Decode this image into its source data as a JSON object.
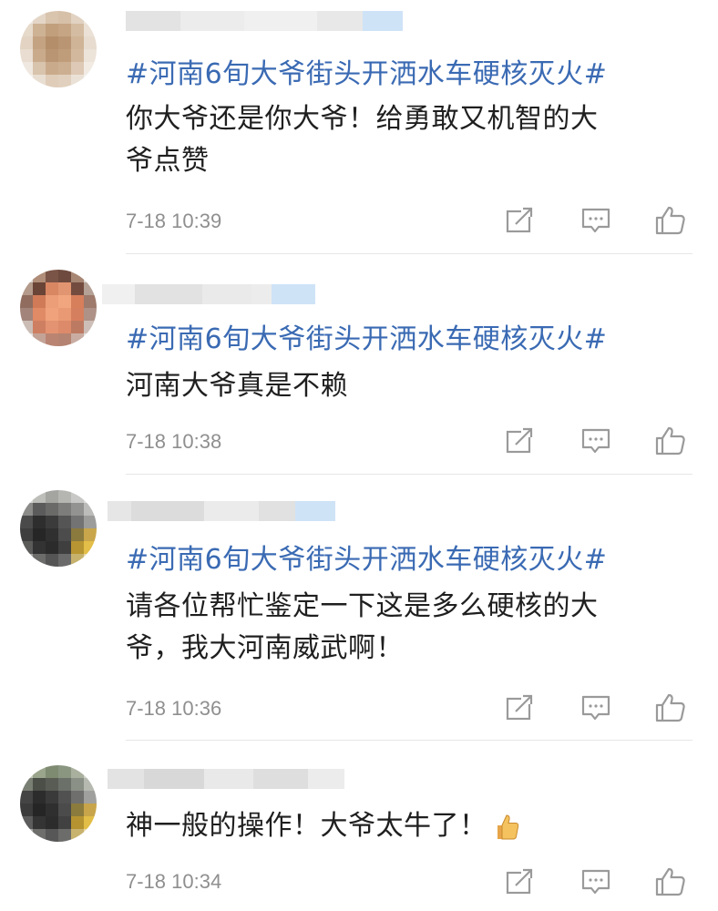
{
  "comments": [
    {
      "hashtag": "#河南6旬大爷街头开洒水车硬核灭火#",
      "lines": [
        "你大爷还是你大爷！给勇敢又机智的大",
        "爷点赞"
      ],
      "time": "7-18 10:39"
    },
    {
      "hashtag": "#河南6旬大爷街头开洒水车硬核灭火#",
      "lines": [
        "河南大爷真是不赖"
      ],
      "time": "7-18 10:38"
    },
    {
      "hashtag": "#河南6旬大爷街头开洒水车硬核灭火#",
      "lines": [
        "请各位帮忙鉴定一下这是多么硬核的大",
        "爷，我大河南威武啊！"
      ],
      "time": "7-18 10:36"
    },
    {
      "hashtag": "",
      "lines": [
        "神一般的操作！大爷太牛了！"
      ],
      "time": "7-18 10:34"
    }
  ],
  "icons": {
    "share": "share-icon",
    "reply": "comment-icon",
    "like": "thumbs-up-icon",
    "emoji": "thumbs-up-emoji"
  },
  "colors": {
    "hashtag": "#3a6ab3",
    "time": "#8f8f8f",
    "icon": "#9a9a9a"
  }
}
